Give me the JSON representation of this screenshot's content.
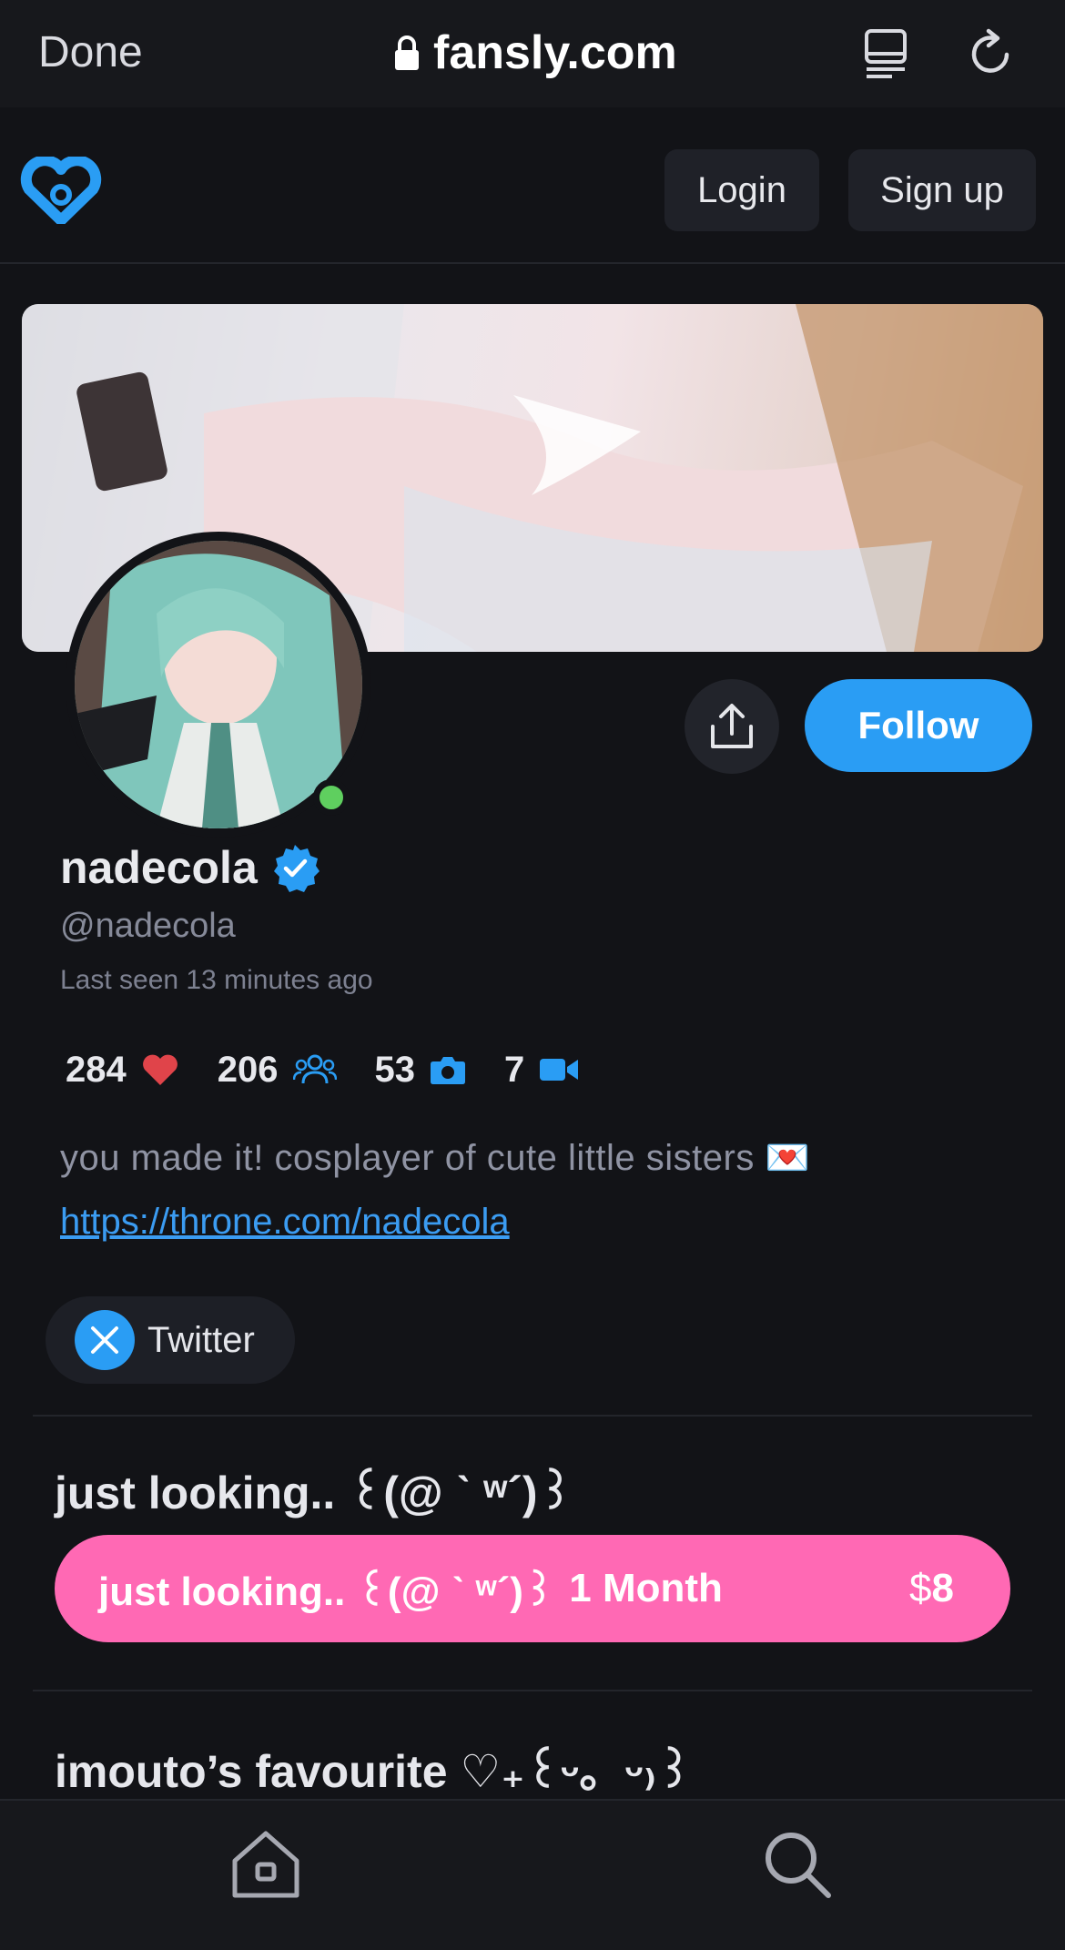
{
  "browser": {
    "done_label": "Done",
    "url": "fansly.com"
  },
  "header": {
    "login_label": "Login",
    "signup_label": "Sign up"
  },
  "profile": {
    "display_name": "nadecola",
    "handle": "@nadecola",
    "last_seen": "Last seen 13 minutes ago",
    "follow_label": "Follow",
    "online": true
  },
  "stats": {
    "likes": "284",
    "followers": "206",
    "photos": "53",
    "videos": "7"
  },
  "bio": {
    "text": "you made it! cosplayer of cute little sisters 💌",
    "link": "https://throne.com/nadecola"
  },
  "socials": {
    "twitter_label": "Twitter"
  },
  "tiers": [
    {
      "title": "just looking.. ꒰(@ ˋ ʷ´)꒱",
      "button_name": "just looking.. ꒰(@ ˋ ʷ´)꒱",
      "duration": "1 Month",
      "currency": "$",
      "price": "8"
    },
    {
      "title": "imouto’s favourite ♡₊꒰ᵕ。ᵕ₎꒱"
    }
  ],
  "colors": {
    "accent_blue": "#2a9df4",
    "tier_pink": "#ff69b4",
    "background": "#121317",
    "like_red": "#e0444a",
    "online_green": "#5fcf5f"
  },
  "icons": {
    "likes": "heart-icon",
    "followers": "people-icon",
    "photos": "camera-icon",
    "videos": "video-icon"
  }
}
